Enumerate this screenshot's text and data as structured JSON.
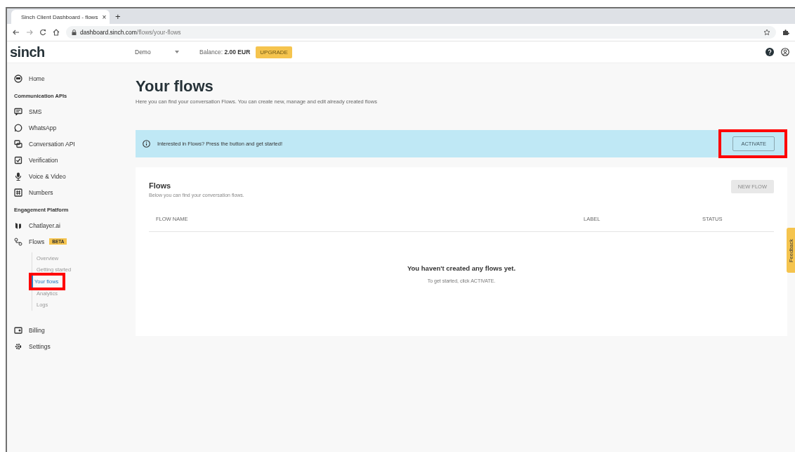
{
  "browser": {
    "tab_title": "Sinch Client Dashboard - flows",
    "tab_close": "×",
    "new_tab": "+",
    "url_host": "dashboard.sinch.com",
    "url_path": "/flows/your-flows"
  },
  "header": {
    "logo": "sinch",
    "account": "Demo",
    "balance_label": "Balance:",
    "balance_value": "2.00 EUR",
    "upgrade": "UPGRADE"
  },
  "sidebar": {
    "items": [
      {
        "kind": "link",
        "label": "Home"
      },
      {
        "kind": "heading",
        "label": "Communication APIs"
      },
      {
        "kind": "link",
        "label": "SMS"
      },
      {
        "kind": "link",
        "label": "WhatsApp"
      },
      {
        "kind": "link",
        "label": "Conversation API"
      },
      {
        "kind": "link",
        "label": "Verification"
      },
      {
        "kind": "link",
        "label": "Voice & Video"
      },
      {
        "kind": "link",
        "label": "Numbers"
      },
      {
        "kind": "heading",
        "label": "Engagement Platform"
      },
      {
        "kind": "link",
        "label": "Chatlayer.ai"
      },
      {
        "kind": "link",
        "label": "Flows",
        "badge": "BETA",
        "children": [
          {
            "label": "Overview",
            "selected": false,
            "highlighted": false
          },
          {
            "label": "Getting started",
            "selected": false,
            "highlighted": false
          },
          {
            "label": "Your flows",
            "selected": true,
            "highlighted": true
          },
          {
            "label": "Analytics",
            "selected": false,
            "highlighted": false
          },
          {
            "label": "Logs",
            "selected": false,
            "highlighted": false
          }
        ]
      },
      {
        "kind": "gap"
      },
      {
        "kind": "link",
        "label": "Billing"
      },
      {
        "kind": "link",
        "label": "Settings"
      }
    ]
  },
  "page": {
    "title": "Your flows",
    "subtitle": "Here you can find your conversation Flows. You can create new, manage and edit already created flows"
  },
  "banner": {
    "text": "Interested in Flows? Press the button and get started!",
    "button": "ACTIVATE",
    "highlighted": true
  },
  "flows_card": {
    "title": "Flows",
    "subtitle": "Below you can find your conversation flows.",
    "new_button": "NEW FLOW",
    "new_disabled": true,
    "columns": [
      "FLOW NAME",
      "LABEL",
      "STATUS"
    ],
    "empty_title": "You haven't created any flows yet.",
    "empty_text": "To get started, click ACTIVATE."
  },
  "feedback_tab": "Feedback"
}
